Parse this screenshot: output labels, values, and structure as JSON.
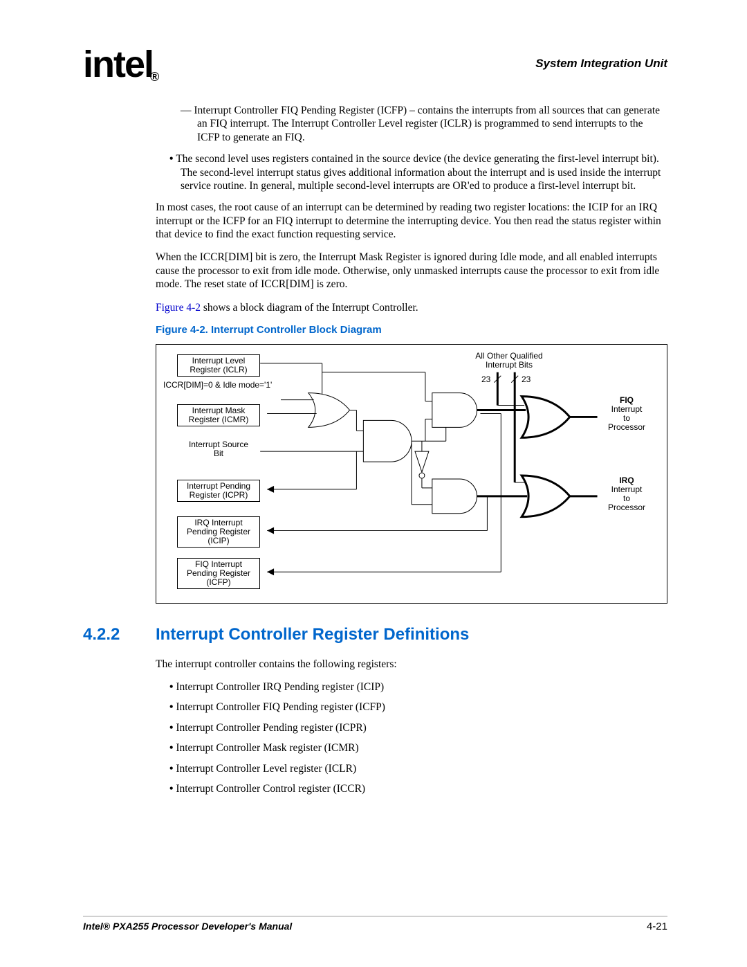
{
  "header": {
    "logo_text": "intel",
    "logo_sub": "®",
    "chapter": "System Integration Unit"
  },
  "body": {
    "dash1": "— Interrupt Controller FIQ Pending Register (ICFP) – contains the interrupts from all sources that can generate an FIQ interrupt. The Interrupt Controller Level register (ICLR) is programmed to send interrupts to the ICFP to generate an FIQ.",
    "bullet1": "The second level uses registers contained in the source device (the device generating the first-level interrupt bit). The second-level interrupt status gives additional information about the interrupt and is used inside the interrupt service routine. In general, multiple second-level interrupts are OR'ed to produce a first-level interrupt bit.",
    "p1": "In most cases, the root cause of an interrupt can be determined by reading two register locations: the ICIP for an IRQ interrupt or the ICFP for an FIQ interrupt to determine the interrupting device. You then read the status register within that device to find the exact function requesting service.",
    "p2": "When the ICCR[DIM] bit is zero, the Interrupt Mask Register is ignored during Idle mode, and all enabled interrupts cause the processor to exit from idle mode. Otherwise, only unmasked interrupts cause the processor to exit from idle mode. The reset state of ICCR[DIM] is zero.",
    "p3_link": "Figure 4-2",
    "p3_rest": " shows a block diagram of the Interrupt Controller.",
    "fig_caption": "Figure 4-2. Interrupt Controller Block Diagram"
  },
  "diagram": {
    "l1": "Interrupt Level\nRegister (ICLR)",
    "l2": "ICCR[DIM]=0 & Idle mode='1'",
    "l3": "Interrupt Mask\nRegister (ICMR)",
    "l4": "Interrupt Source\nBit",
    "l5": "Interrupt Pending\nRegister (ICPR)",
    "l6": "IRQ Interrupt\nPending Register\n(ICIP)",
    "l7": "FIQ Interrupt\nPending Register\n(ICFP)",
    "r1": "All Other Qualified\nInterrupt Bits",
    "r2a": "23",
    "r2b": "23",
    "r3_bold": "FIQ",
    "r3": "Interrupt\nto\nProcessor",
    "r4_bold": "IRQ",
    "r4": "Interrupt\nto\nProcessor"
  },
  "section": {
    "num": "4.2.2",
    "title": "Interrupt Controller Register Definitions",
    "intro": "The interrupt controller contains the following registers:",
    "items": [
      "Interrupt Controller IRQ Pending register (ICIP)",
      "Interrupt Controller FIQ Pending register (ICFP)",
      "Interrupt Controller Pending register (ICPR)",
      "Interrupt Controller Mask register (ICMR)",
      "Interrupt Controller Level register (ICLR)",
      "Interrupt Controller Control register (ICCR)"
    ]
  },
  "footer": {
    "title": "Intel® PXA255 Processor Developer's Manual",
    "page": "4-21"
  }
}
